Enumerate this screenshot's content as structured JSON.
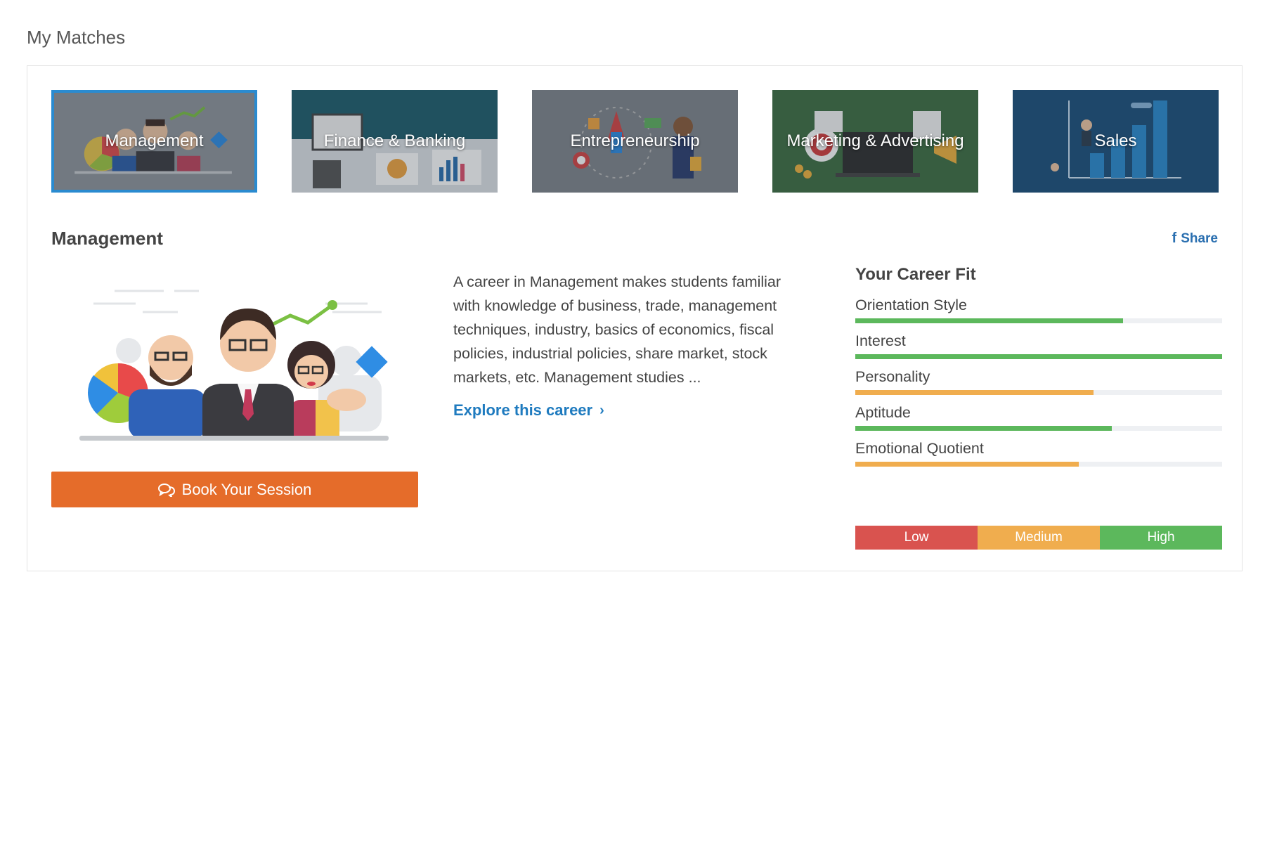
{
  "page": {
    "title": "My Matches"
  },
  "tiles": [
    {
      "label": "Management",
      "active": true,
      "color": "#8a9096"
    },
    {
      "label": "Finance & Banking",
      "active": false,
      "color": "#1f5d6a"
    },
    {
      "label": "Entrepreneurship",
      "active": false,
      "color": "#7d8287"
    },
    {
      "label": "Marketing & Advertising",
      "active": false,
      "color": "#3a6b3f"
    },
    {
      "label": "Sales",
      "active": false,
      "color": "#1c4f7a"
    }
  ],
  "detail": {
    "title": "Management",
    "share_label": "Share",
    "description": "A career in Management makes students familiar with knowledge of business, trade, management techniques, industry, basics of economics, fiscal policies, industrial policies, share market, stock markets, etc. Management studies ...",
    "explore_label": "Explore this career",
    "book_label": "Book Your Session"
  },
  "career_fit": {
    "title": "Your Career Fit",
    "items": [
      {
        "label": "Orientation Style",
        "value": 73,
        "level": "high"
      },
      {
        "label": "Interest",
        "value": 100,
        "level": "high"
      },
      {
        "label": "Personality",
        "value": 65,
        "level": "medium"
      },
      {
        "label": "Aptitude",
        "value": 70,
        "level": "high"
      },
      {
        "label": "Emotional Quotient",
        "value": 61,
        "level": "medium"
      }
    ],
    "legend": [
      {
        "label": "Low",
        "color": "#d9534f"
      },
      {
        "label": "Medium",
        "color": "#f0ad4e"
      },
      {
        "label": "High",
        "color": "#5cb85c"
      }
    ]
  },
  "colors": {
    "accent": "#e56c2a",
    "link": "#1f7bbf",
    "active_border": "#2a8bd0",
    "high": "#5cb85c",
    "medium": "#f0ad4e"
  },
  "icons": {
    "share": "facebook-icon",
    "book": "chat-bubbles-icon",
    "explore": "chevron-right-icon"
  }
}
